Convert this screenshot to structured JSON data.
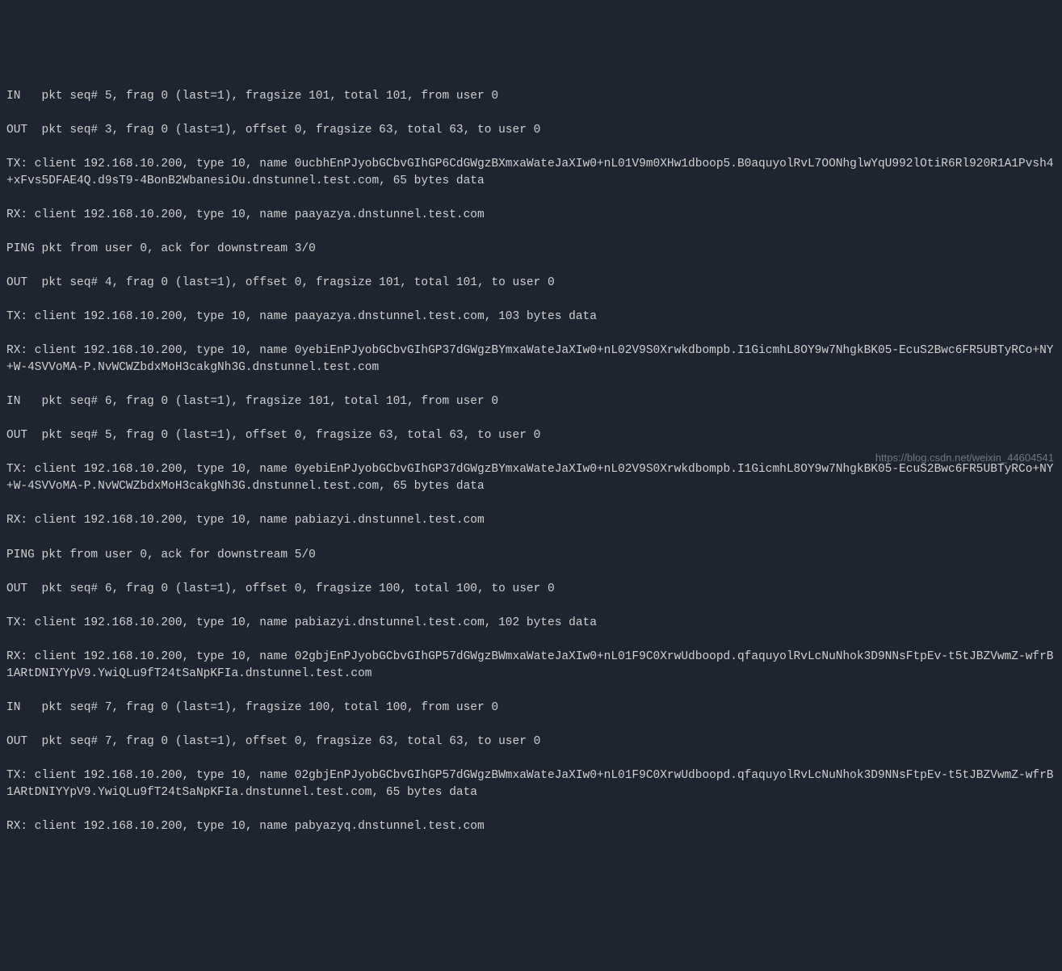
{
  "terminal": {
    "lines": [
      "IN   pkt seq# 5, frag 0 (last=1), fragsize 101, total 101, from user 0",
      "OUT  pkt seq# 3, frag 0 (last=1), offset 0, fragsize 63, total 63, to user 0",
      "TX: client 192.168.10.200, type 10, name 0ucbhEnPJyobGCbvGIhGP6CdGWgzBXmxaWateJaXIw0+nL01V9m0XHw1dboop5.B0aquyolRvL7OONhglwYqU992lOtiR6Rl920R1A1Pvsh4+xFvs5DFAE4Q.d9sT9-4BonB2WbanesiOu.dnstunnel.test.com, 65 bytes data",
      "RX: client 192.168.10.200, type 10, name paayazya.dnstunnel.test.com",
      "PING pkt from user 0, ack for downstream 3/0",
      "OUT  pkt seq# 4, frag 0 (last=1), offset 0, fragsize 101, total 101, to user 0",
      "TX: client 192.168.10.200, type 10, name paayazya.dnstunnel.test.com, 103 bytes data",
      "RX: client 192.168.10.200, type 10, name 0yebiEnPJyobGCbvGIhGP37dGWgzBYmxaWateJaXIw0+nL02V9S0Xrwkdbompb.I1GicmhL8OY9w7NhgkBK05-EcuS2Bwc6FR5UBTyRCo+NY+W-4SVVoMA-P.NvWCWZbdxMoH3cakgNh3G.dnstunnel.test.com",
      "IN   pkt seq# 6, frag 0 (last=1), fragsize 101, total 101, from user 0",
      "OUT  pkt seq# 5, frag 0 (last=1), offset 0, fragsize 63, total 63, to user 0",
      "TX: client 192.168.10.200, type 10, name 0yebiEnPJyobGCbvGIhGP37dGWgzBYmxaWateJaXIw0+nL02V9S0Xrwkdbompb.I1GicmhL8OY9w7NhgkBK05-EcuS2Bwc6FR5UBTyRCo+NY+W-4SVVoMA-P.NvWCWZbdxMoH3cakgNh3G.dnstunnel.test.com, 65 bytes data",
      "RX: client 192.168.10.200, type 10, name pabiazyi.dnstunnel.test.com",
      "PING pkt from user 0, ack for downstream 5/0",
      "OUT  pkt seq# 6, frag 0 (last=1), offset 0, fragsize 100, total 100, to user 0",
      "TX: client 192.168.10.200, type 10, name pabiazyi.dnstunnel.test.com, 102 bytes data",
      "RX: client 192.168.10.200, type 10, name 02gbjEnPJyobGCbvGIhGP57dGWgzBWmxaWateJaXIw0+nL01F9C0XrwUdboopd.qfaquyolRvLcNuNhok3D9NNsFtpEv-t5tJBZVwmZ-wfrB1ARtDNIYYpV9.YwiQLu9fT24tSaNpKFIa.dnstunnel.test.com",
      "IN   pkt seq# 7, frag 0 (last=1), fragsize 100, total 100, from user 0",
      "OUT  pkt seq# 7, frag 0 (last=1), offset 0, fragsize 63, total 63, to user 0",
      "TX: client 192.168.10.200, type 10, name 02gbjEnPJyobGCbvGIhGP57dGWgzBWmxaWateJaXIw0+nL01F9C0XrwUdboopd.qfaquyolRvLcNuNhok3D9NNsFtpEv-t5tJBZVwmZ-wfrB1ARtDNIYYpV9.YwiQLu9fT24tSaNpKFIa.dnstunnel.test.com, 65 bytes data",
      "RX: client 192.168.10.200, type 10, name pabyazyq.dnstunnel.test.com"
    ]
  },
  "watermark": "https://blog.csdn.net/weixin_44604541"
}
